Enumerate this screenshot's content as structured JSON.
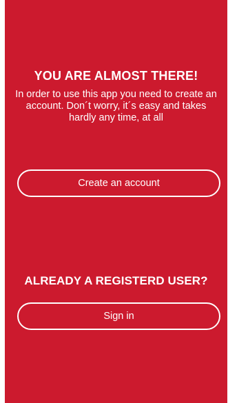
{
  "colors": {
    "background": "#cc1a2e",
    "text": "#ffffff",
    "page_edge": "#ffffff"
  },
  "intro": {
    "heading": "YOU ARE ALMOST THERE!",
    "body": "In order to use this app you need to create an account. Don´t worry, it´s easy and takes hardly any time, at all"
  },
  "create_account": {
    "label": "Create an account"
  },
  "existing_user": {
    "heading": "ALREADY A REGISTERD USER?",
    "sign_in_label": "Sign in"
  }
}
